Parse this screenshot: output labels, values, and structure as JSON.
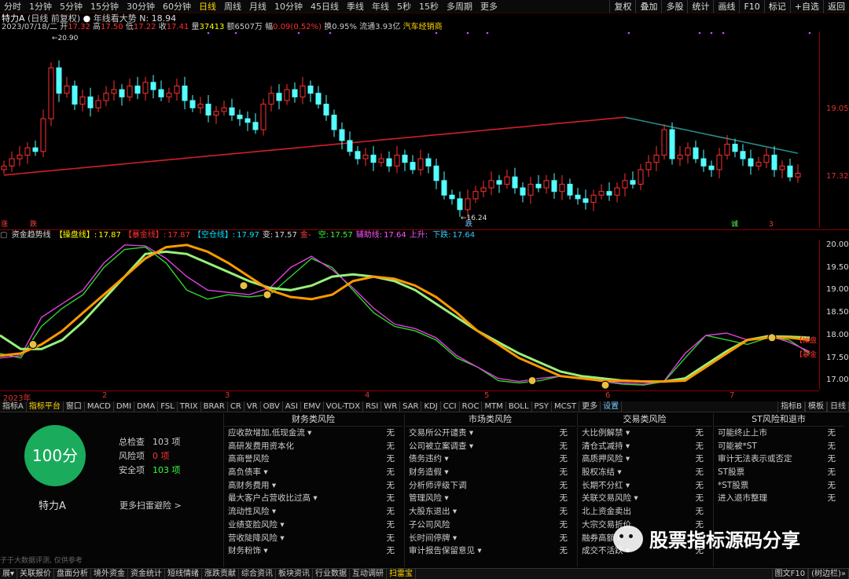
{
  "topbar": {
    "timeframes": [
      "分时",
      "1分钟",
      "5分钟",
      "15分钟",
      "30分钟",
      "60分钟",
      "日线",
      "周线",
      "月线",
      "10分钟",
      "45日线",
      "季线",
      "年线",
      "5秒",
      "15秒",
      "多周期",
      "更多"
    ],
    "active_index": 6,
    "right_buttons": [
      "复权",
      "叠加",
      "多股",
      "统计",
      "画线",
      "F10",
      "标记",
      "+自选",
      "返回"
    ]
  },
  "info": {
    "stock": "特力A",
    "mode": "(日线 前复权)",
    "indicator_name": "年线看大势",
    "indicator_value": "N: 18.94",
    "date": "2023/07/18/二",
    "open_label": "开",
    "open": "17.32",
    "high_label": "高",
    "high": "17.50",
    "low_label": "低",
    "low": "17.22",
    "close_label": "收",
    "close": "17.41",
    "vol_label": "量",
    "vol": "37413",
    "amount_label": "额",
    "amount": "6507万",
    "change_label": "幅",
    "change": "0.09(0.52%)",
    "turnover_label": "换",
    "turnover": "0.95%",
    "float_label": "流通",
    "float_cap": "3.93亿",
    "industry": "汽车经销商"
  },
  "main_axis": {
    "labels": [
      "19.05",
      "17.32"
    ]
  },
  "annotations": {
    "high_label": "20.90",
    "low_label": "16.24",
    "marks": [
      "涨",
      "跌",
      "跌",
      "诚",
      "3"
    ]
  },
  "indicator": {
    "name": "资金趋势线",
    "items": [
      {
        "label": "【操盘线】:",
        "value": "17.87",
        "color": "#ffff00"
      },
      {
        "label": "【暴金线】:",
        "value": "17.87",
        "color": "#ff3030"
      },
      {
        "label": "【空仓线】:",
        "value": "17.97",
        "color": "#00e5ff"
      },
      {
        "label": "变:",
        "value": "17.57",
        "color": "#dddddd"
      },
      {
        "label": "金- ",
        "value": "",
        "color": "#ff4040"
      },
      {
        "label": "空:",
        "value": "17.57",
        "color": "#33ff33"
      },
      {
        "label": "辅助线:",
        "value": "17.64",
        "color": "#ff55ff"
      },
      {
        "label": "上升:",
        "value": "",
        "color": "#ff55ff"
      },
      {
        "label": "下跌:",
        "value": "17.64",
        "color": "#33ccff"
      }
    ],
    "axis_labels": [
      "20.00",
      "19.50",
      "19.00",
      "18.50",
      "18.00",
      "17.50",
      "17.00"
    ],
    "legend_right": [
      "【操盘",
      "【暴金"
    ]
  },
  "datebar": {
    "year": "2023年",
    "months": [
      "2",
      "3",
      "4",
      "5",
      "6",
      "7"
    ]
  },
  "tabs": {
    "items": [
      "指标A",
      "指标平台",
      "窗口",
      "MACD",
      "DMI",
      "DMA",
      "FSL",
      "TRIX",
      "BRAR",
      "CR",
      "VR",
      "OBV",
      "ASI",
      "EMV",
      "VOL-TDX",
      "RSI",
      "WR",
      "SAR",
      "KDJ",
      "CCI",
      "ROC",
      "MTM",
      "BOLL",
      "PSY",
      "MCST",
      "更多",
      "设置"
    ],
    "active_index": 1,
    "right": [
      "指标B",
      "模板",
      "日线"
    ]
  },
  "panel": {
    "score": "100分",
    "name": "特力A",
    "stats": [
      {
        "label": "总检查",
        "value": "103 项",
        "color": "#cccccc"
      },
      {
        "label": "风险项",
        "value": "0 项",
        "color": "#ff3030"
      },
      {
        "label": "安全项",
        "value": "103 项",
        "color": "#33ff33"
      }
    ],
    "more_scan": "更多扫雷避险 >",
    "note": "子于大数据评测, 仅供参考",
    "columns": [
      {
        "title": "财务类风险",
        "rows": [
          [
            "应收款增加,低现金流 ▾",
            "无"
          ],
          [
            "高研发费用资本化",
            "无"
          ],
          [
            "高商誉风险",
            "无"
          ],
          [
            "高负债率 ▾",
            "无"
          ],
          [
            "高财务费用 ▾",
            "无"
          ],
          [
            "最大客户占营收比过高 ▾",
            "无"
          ],
          [
            "流动性风险 ▾",
            "无"
          ],
          [
            "业绩变脸风险 ▾",
            "无"
          ],
          [
            "营收陡降风险 ▾",
            "无"
          ],
          [
            "财务粉饰 ▾",
            "无"
          ]
        ]
      },
      {
        "title": "市场类风险",
        "rows": [
          [
            "交易所公开谴责 ▾",
            "无"
          ],
          [
            "公司被立案调查 ▾",
            "无"
          ],
          [
            "债务违约 ▾",
            "无"
          ],
          [
            "财务造假 ▾",
            "无"
          ],
          [
            "分析师评级下调",
            "无"
          ],
          [
            "管理风险 ▾",
            "无"
          ],
          [
            "大股东退出 ▾",
            "无"
          ],
          [
            "子公司风险",
            "无"
          ],
          [
            "长时间停牌 ▾",
            "无"
          ],
          [
            "审计报告保留意见 ▾",
            "无"
          ]
        ]
      },
      {
        "title": "交易类风险",
        "rows": [
          [
            "大比例解禁 ▾",
            "无"
          ],
          [
            "清仓式减持 ▾",
            "无"
          ],
          [
            "高质押风险 ▾",
            "无"
          ],
          [
            "股权冻结 ▾",
            "无"
          ],
          [
            "长期不分红 ▾",
            "无"
          ],
          [
            "关联交易风险 ▾",
            "无"
          ],
          [
            "北上资金卖出",
            "无"
          ],
          [
            "大宗交易折价",
            "无"
          ],
          [
            "融券高额 ▾",
            "无"
          ],
          [
            "成交不活跃 ▾",
            "无"
          ]
        ]
      },
      {
        "title": "ST风险和退市",
        "rows": [
          [
            "可能终止上市",
            "无"
          ],
          [
            "可能被*ST",
            "无"
          ],
          [
            "审计无法表示或否定",
            "无"
          ],
          [
            "ST股票",
            "无"
          ],
          [
            "*ST股票",
            "无"
          ],
          [
            "进入退市整理",
            "无"
          ]
        ]
      }
    ]
  },
  "bottombar": {
    "items": [
      "展▾",
      "关联报价",
      "盘面分析",
      "境外资金",
      "资金统计",
      "短线情绪",
      "涨跌贡献",
      "综合资讯",
      "板块资讯",
      "行业数据",
      "互动调研",
      "扫雷宝"
    ],
    "active_index": 11,
    "right": [
      "图文F10",
      "(树边栏)»"
    ]
  },
  "watermark": "股票指标源码分享",
  "chart_data": {
    "type": "candlestick",
    "title": "",
    "x": [
      "2023-01",
      "2023-02",
      "2023-03",
      "2023-04",
      "2023-05",
      "2023-06",
      "2023-07"
    ],
    "price_range": [
      15.9,
      21.3
    ],
    "ma_year_start": 17.35,
    "ma_year_peak": 18.94,
    "closes": [
      17.6,
      17.8,
      17.9,
      18.1,
      18.0,
      18.9,
      20.3,
      19.6,
      19.8,
      19.3,
      19.5,
      19.2,
      19.4,
      19.6,
      19.7,
      19.5,
      19.8,
      19.6,
      19.9,
      19.7,
      19.5,
      19.6,
      19.8,
      19.4,
      19.2,
      19.3,
      19.0,
      19.1,
      19.2,
      19.0,
      18.9,
      18.8,
      18.6,
      19.3,
      19.6,
      19.4,
      19.7,
      19.5,
      19.8,
      19.6,
      19.3,
      19.0,
      18.6,
      18.3,
      18.0,
      17.8,
      17.9,
      17.7,
      17.8,
      17.6,
      17.9,
      17.7,
      17.5,
      17.8,
      17.6,
      17.2,
      16.8,
      16.7,
      16.4,
      16.7,
      16.9,
      17.0,
      17.2,
      17.1,
      17.3,
      17.0,
      16.8,
      17.1,
      17.0,
      17.2,
      16.9,
      17.1,
      16.8,
      16.7,
      16.6,
      16.8,
      16.9,
      16.8,
      17.0,
      17.2,
      17.1,
      17.5,
      17.7,
      17.9,
      18.6,
      17.8,
      17.9,
      18.1,
      17.8,
      17.6,
      17.5,
      17.9,
      18.2,
      18.0,
      17.8,
      17.6,
      17.7,
      17.9,
      17.5,
      17.6,
      17.3,
      17.4
    ],
    "indicator_range": [
      16.8,
      20.1
    ],
    "series": [
      {
        "name": "【操盘线】",
        "values": [
          17.55,
          17.6,
          17.8,
          18.1,
          18.5,
          18.9,
          19.3,
          19.7,
          19.95,
          20.0,
          19.85,
          19.6,
          19.3,
          19.0,
          18.85,
          18.8,
          18.9,
          19.2,
          19.3,
          19.25,
          19.1,
          18.85,
          18.5,
          18.1,
          17.8,
          17.5,
          17.3,
          17.1,
          17.05,
          17.0,
          17.0,
          16.98,
          16.98,
          17.0,
          17.3,
          17.6,
          17.9,
          17.95,
          17.95,
          17.9
        ]
      },
      {
        "name": "【空仓线】",
        "values": [
          18.0,
          17.7,
          17.7,
          17.9,
          18.3,
          18.8,
          19.3,
          19.8,
          19.85,
          19.8,
          19.6,
          19.4,
          19.2,
          19.05,
          19.0,
          19.1,
          19.3,
          19.35,
          19.3,
          19.2,
          19.0,
          18.7,
          18.4,
          18.1,
          17.85,
          17.6,
          17.4,
          17.2,
          17.1,
          17.05,
          17.0,
          16.98,
          16.98,
          17.05,
          17.35,
          17.65,
          17.9,
          17.98,
          17.97,
          17.95
        ]
      },
      {
        "name": "空",
        "values": [
          17.6,
          17.5,
          18.2,
          18.6,
          18.9,
          19.5,
          19.9,
          19.95,
          19.6,
          19.0,
          18.8,
          18.9,
          18.85,
          18.9,
          19.3,
          19.7,
          19.5,
          19.0,
          18.5,
          18.2,
          18.1,
          17.9,
          17.5,
          17.3,
          17.0,
          16.95,
          17.0,
          17.1,
          17.05,
          16.98,
          16.92,
          16.9,
          16.98,
          17.5,
          18.0,
          17.9,
          17.8,
          17.95,
          17.9,
          17.6
        ]
      },
      {
        "name": "辅助线",
        "values": [
          17.5,
          17.55,
          18.4,
          18.7,
          19.0,
          19.6,
          20.0,
          19.98,
          19.7,
          19.3,
          19.0,
          18.95,
          18.9,
          19.05,
          19.5,
          19.75,
          19.45,
          19.05,
          18.6,
          18.25,
          18.15,
          17.95,
          17.55,
          17.3,
          17.05,
          16.98,
          17.05,
          17.1,
          17.05,
          16.98,
          16.95,
          16.92,
          17.0,
          17.6,
          18.0,
          18.05,
          17.9,
          18.0,
          17.85,
          17.64
        ]
      }
    ],
    "grid": false
  }
}
